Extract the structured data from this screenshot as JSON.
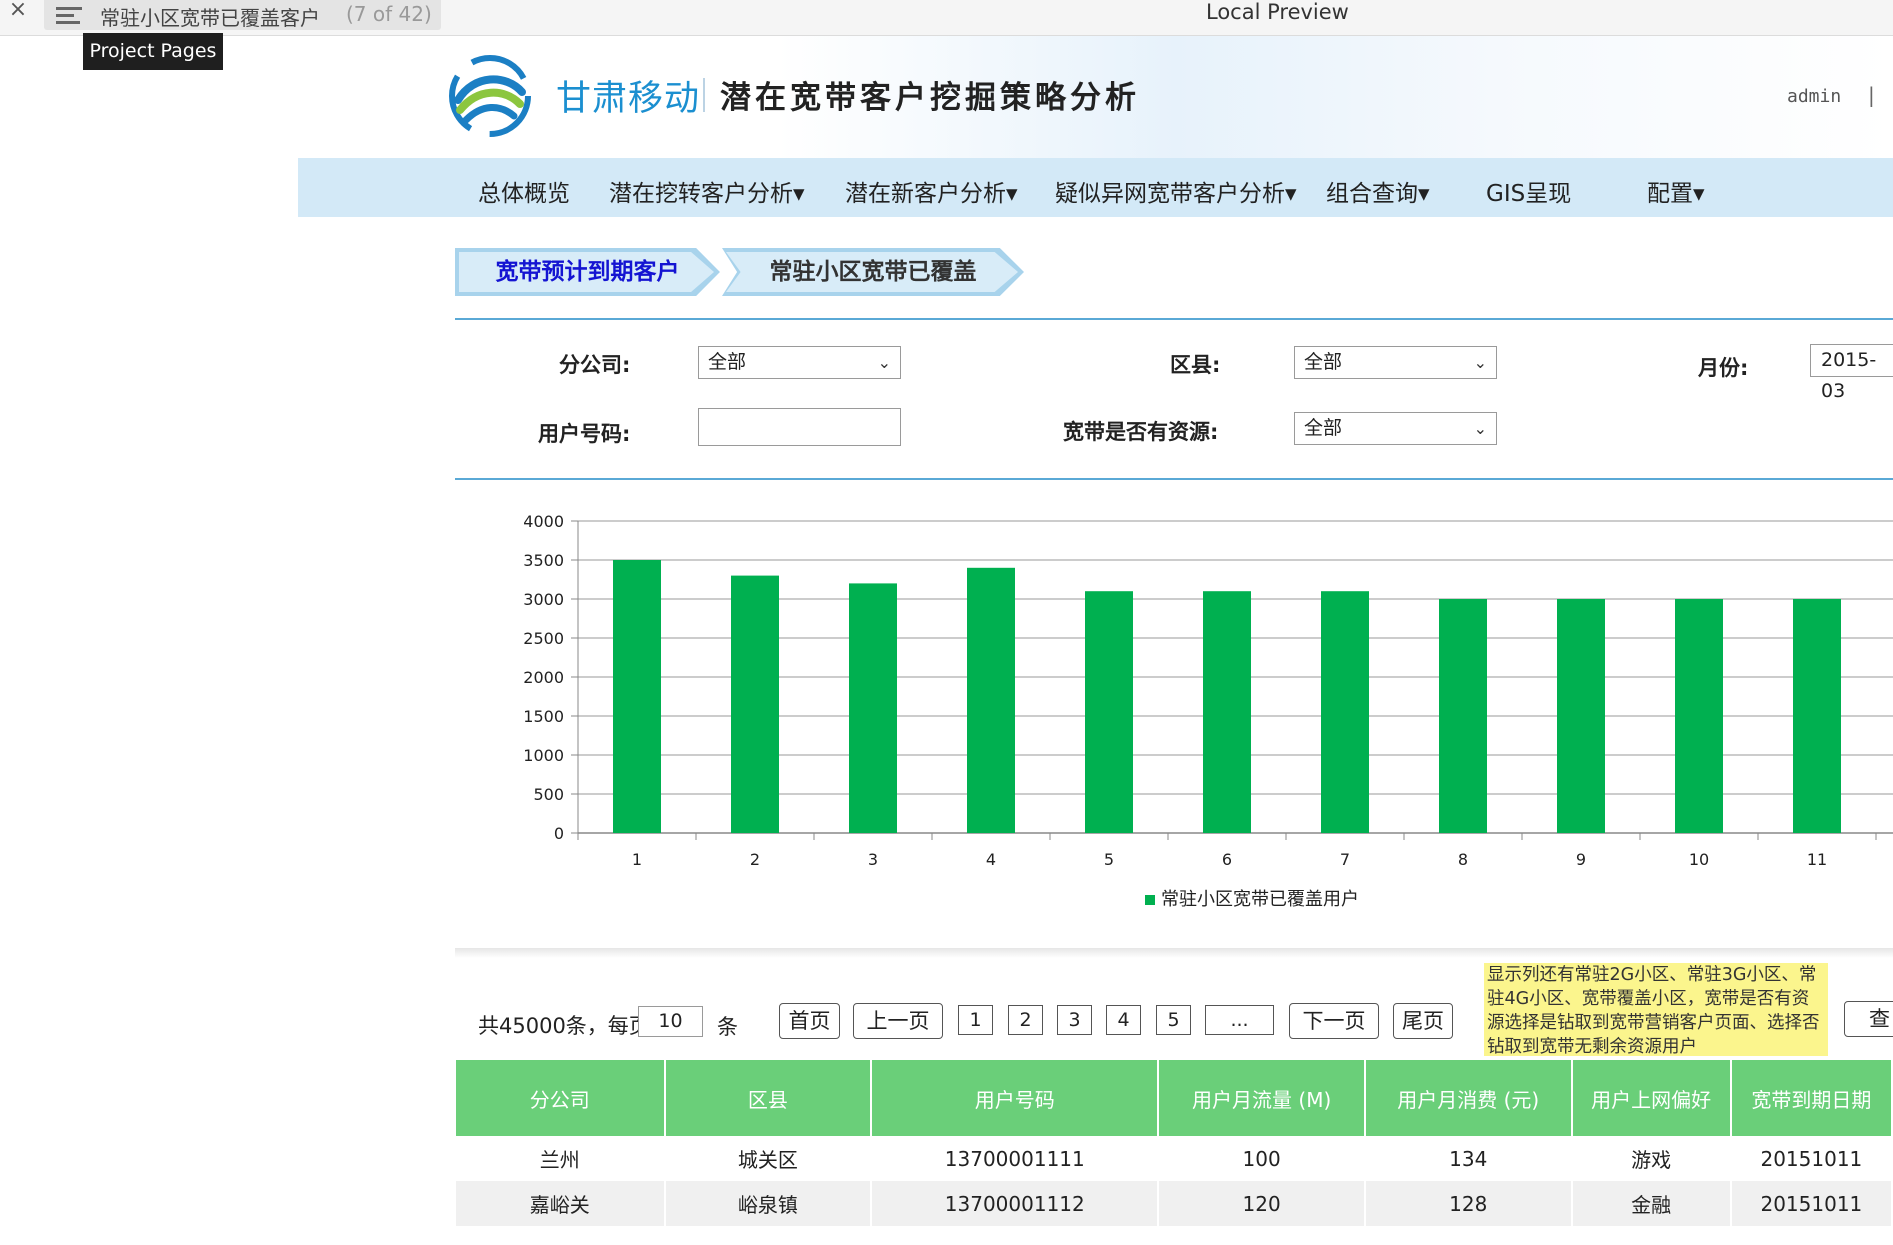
{
  "browser": {
    "close_glyph": "×",
    "page_title": "常驻小区宽带已覆盖客户",
    "page_count": "(7 of 42)",
    "preview_title": "Local Preview",
    "tooltip": "Project Pages"
  },
  "header": {
    "brand": "甘肃移动",
    "title": "潜在宽带客户挖掘策略分析",
    "user": "admin",
    "separator": "|"
  },
  "nav": {
    "items": [
      "总体概览",
      "潜在挖转客户分析▾",
      "潜在新客户分析▾",
      "疑似异网宽带客户分析▾",
      "组合查询▾",
      "GIS呈现",
      "配置▾"
    ]
  },
  "tabs": {
    "tab1": "宽带预计到期客户",
    "tab2": "常驻小区宽带已覆盖"
  },
  "filters": {
    "branch_label": "分公司:",
    "branch_value": "全部",
    "county_label": "区县:",
    "county_value": "全部",
    "month_label": "月份:",
    "month_value": "2015-03",
    "phone_label": "用户号码:",
    "phone_value": "",
    "resource_label": "宽带是否有资源:",
    "resource_value": "全部",
    "chevron": "⌄"
  },
  "chart_data": {
    "type": "bar",
    "categories": [
      "1",
      "2",
      "3",
      "4",
      "5",
      "6",
      "7",
      "8",
      "9",
      "10",
      "11"
    ],
    "series": [
      {
        "name": "常驻小区宽带已覆盖用户",
        "values": [
          3500,
          3300,
          3200,
          3400,
          3100,
          3100,
          3100,
          3000,
          3000,
          3000,
          3000
        ],
        "color": "#00b050"
      }
    ],
    "yticks": [
      "0",
      "500",
      "1000",
      "1500",
      "2000",
      "2500",
      "3000",
      "3500",
      "4000"
    ],
    "ylim": [
      0,
      4000
    ],
    "grid": true,
    "legend_position": "bottom"
  },
  "pager": {
    "total_prefix": "共45000条，每页",
    "per_page": "10",
    "unit": "条",
    "first": "首页",
    "prev": "上一页",
    "pages": [
      "1",
      "2",
      "3",
      "4",
      "5",
      "..."
    ],
    "next": "下一页",
    "last": "尾页"
  },
  "note": "显示列还有常驻2G小区、常驻3G小区、常驻4G小区、宽带覆盖小区，宽带是否有资源选择是钻取到宽带营销客户页面、选择否钻取到宽带无剩余资源用户",
  "query_button": "查",
  "table": {
    "headers": [
      "分公司",
      "区县",
      "用户号码",
      "用户月流量 (M)",
      "用户月消费 (元)",
      "用户上网偏好",
      "宽带到期日期"
    ],
    "rows": [
      [
        "兰州",
        "城关区",
        "13700001111",
        "100",
        "134",
        "游戏",
        "20151011"
      ],
      [
        "嘉峪关",
        "峪泉镇",
        "13700001112",
        "120",
        "128",
        "金融",
        "20151011"
      ]
    ]
  }
}
